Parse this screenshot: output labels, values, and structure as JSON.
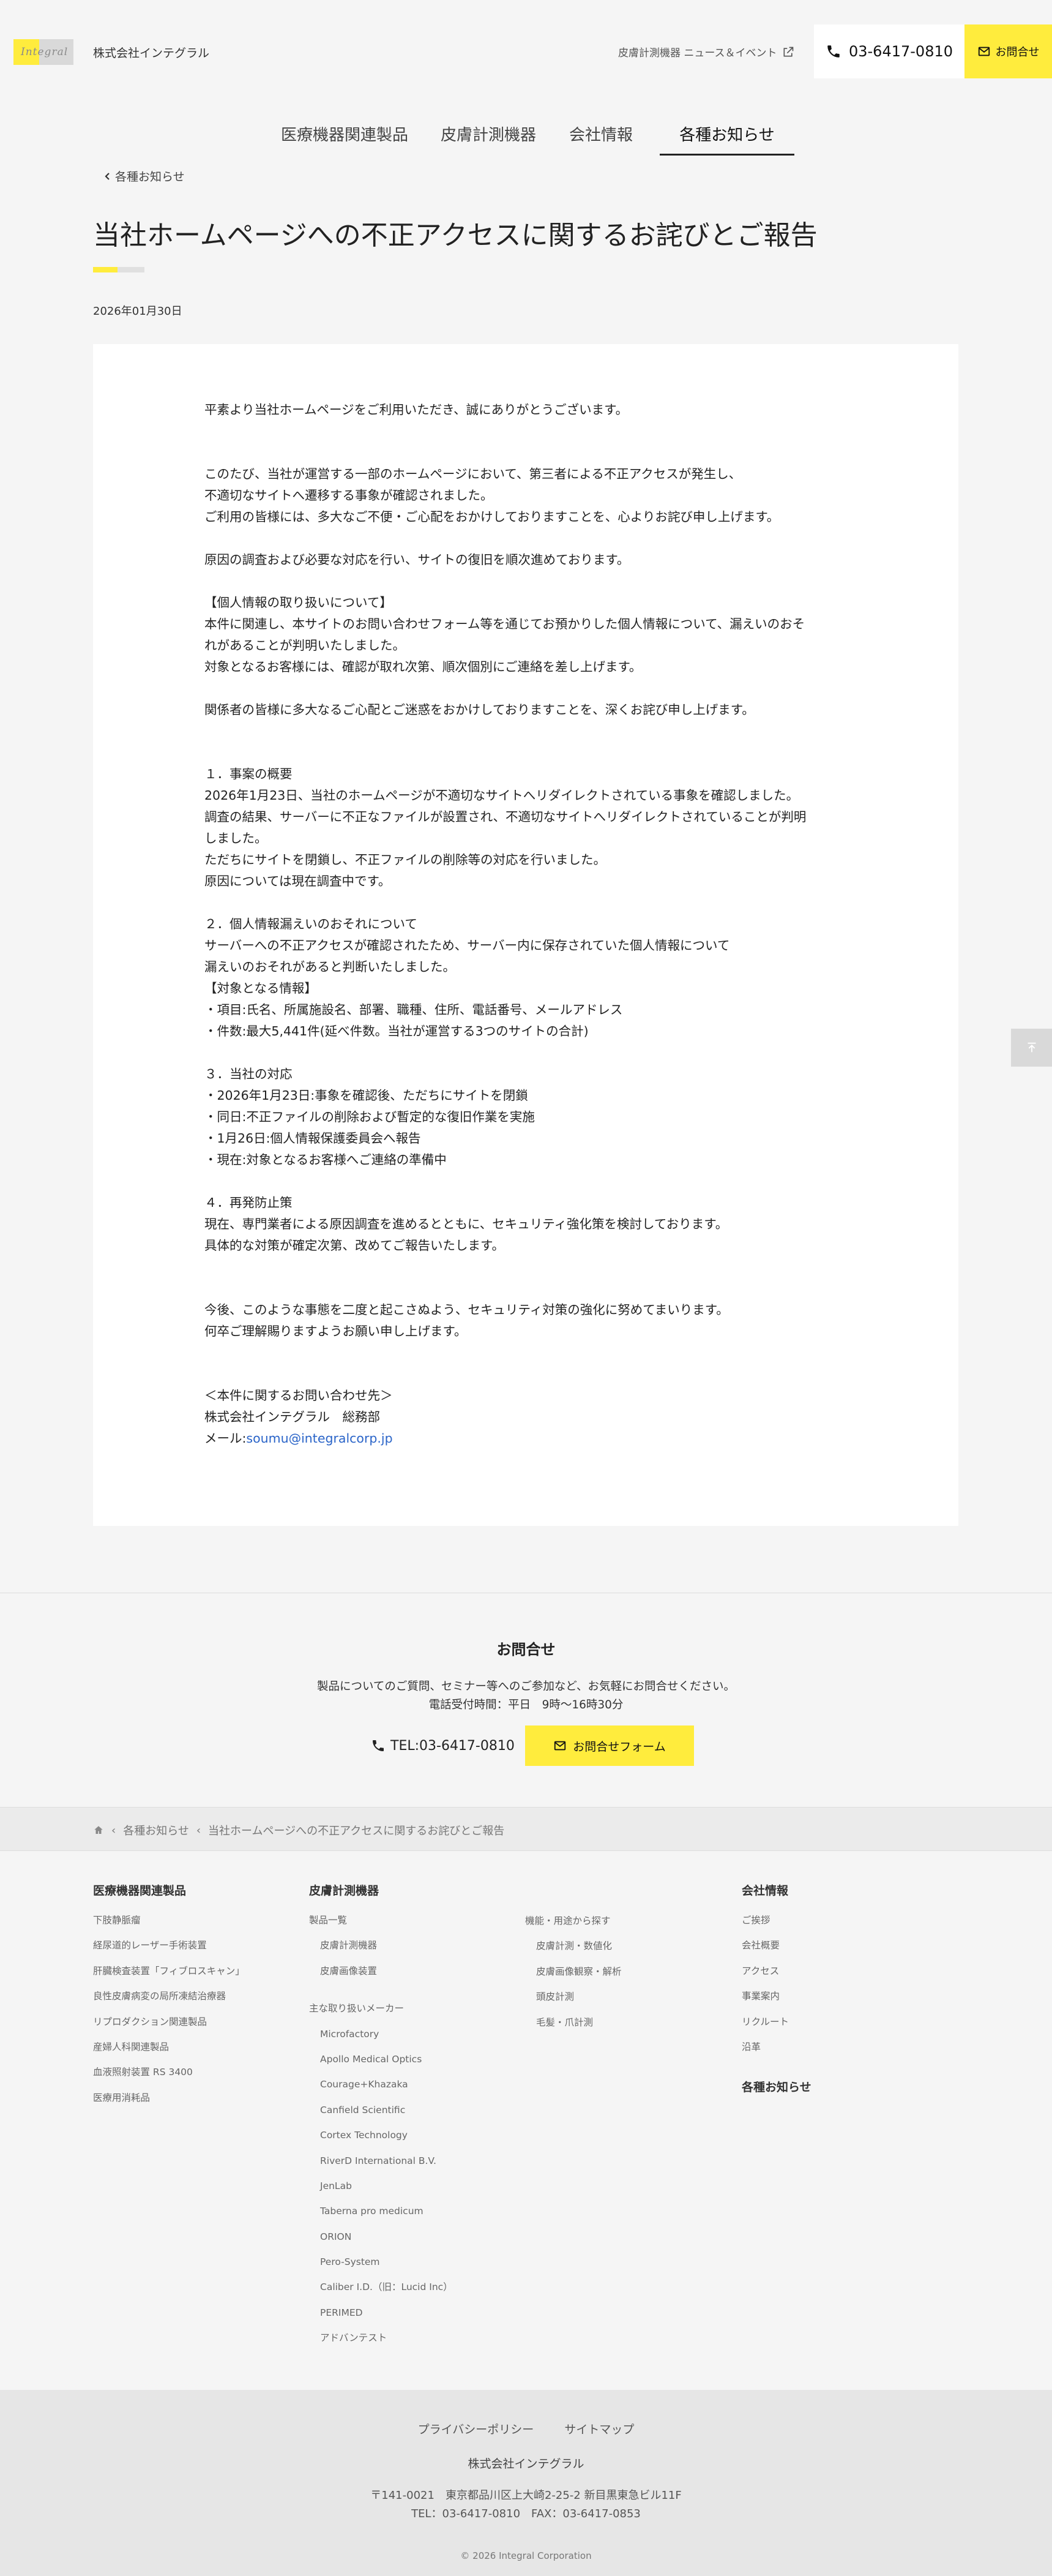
{
  "header": {
    "logo_text": "Integral",
    "company_name": "株式会社インテグラル",
    "news_link": "皮膚計測機器 ニュース＆イベント",
    "tel": "03-6417-0810",
    "contact": "お問合せ"
  },
  "nav": {
    "items": [
      "医療機器関連製品",
      "皮膚計測機器",
      "会社情報",
      "各種お知らせ"
    ],
    "active": "各種お知らせ"
  },
  "back_link": "各種お知らせ",
  "article": {
    "title": "当社ホームページへの不正アクセスに関するお詫びとご報告",
    "date": "2026年01月30日",
    "greeting": "平素より当社ホームページをご利用いただき、誠にありがとうございます。",
    "intro": [
      "このたび、当社が運営する一部のホームページにおいて、第三者による不正アクセスが発生し、",
      "不適切なサイトへ遷移する事象が確認されました。",
      "ご利用の皆様には、多大なご不便・ご心配をおかけしておりますことを、心よりお詫び申し上げます。"
    ],
    "recovery": "原因の調査および必要な対応を行い、サイトの復旧を順次進めております。",
    "personal_info": [
      "【個人情報の取り扱いについて】",
      "本件に関連し、本サイトのお問い合わせフォーム等を通じてお預かりした個人情報について、漏えいのおそ",
      "れがあることが判明いたしました。",
      "対象となるお客様には、確認が取れ次第、順次個別にご連絡を差し上げます。"
    ],
    "apology": "関係者の皆様に多大なるご心配とご迷惑をおかけしておりますことを、深くお詫び申し上げます。",
    "section1": [
      "１．事案の概要",
      "2026年1月23日、当社のホームページが不適切なサイトへリダイレクトされている事象を確認しました。",
      "調査の結果、サーバーに不正なファイルが設置され、不適切なサイトへリダイレクトされていることが判明",
      "しました。",
      "ただちにサイトを閉鎖し、不正ファイルの削除等の対応を行いました。",
      "原因については現在調査中です。"
    ],
    "section2": [
      "２．個人情報漏えいのおそれについて",
      "サーバーへの不正アクセスが確認されたため、サーバー内に保存されていた個人情報について",
      "漏えいのおそれがあると判断いたしました。",
      "【対象となる情報】",
      "・項目:氏名、所属施設名、部署、職種、住所、電話番号、メールアドレス",
      "・件数:最大5,441件(延べ件数。当社が運営する3つのサイトの合計)"
    ],
    "section3": [
      "３．当社の対応",
      "・2026年1月23日:事象を確認後、ただちにサイトを閉鎖",
      "・同日:不正ファイルの削除および暫定的な復旧作業を実施",
      "・1月26日:個人情報保護委員会へ報告",
      "・現在:対象となるお客様へご連絡の準備中"
    ],
    "section4": [
      "４．再発防止策",
      "現在、専門業者による原因調査を進めるとともに、セキュリティ強化策を検討しております。",
      "具体的な対策が確定次第、改めてご報告いたします。"
    ],
    "closing": [
      "今後、このような事態を二度と起こさぬよう、セキュリティ対策の強化に努めてまいります。",
      "何卒ご理解賜りますようお願い申し上げます。"
    ],
    "inquiry": {
      "heading": "＜本件に関するお問い合わせ先＞",
      "dept": "株式会社インテグラル　総務部",
      "mail_label": "メール:",
      "mail": "soumu@integralcorp.jp"
    }
  },
  "contact_section": {
    "title": "お問合せ",
    "desc1": "製品についてのご質問、セミナー等へのご参加など、お気軽にお問合せください。",
    "desc2": "電話受付時間：平日　9時〜16時30分",
    "tel": "TEL:03-6417-0810",
    "form": "お問合せフォーム"
  },
  "breadcrumb": [
    "各種お知らせ",
    "当社ホームページへの不正アクセスに関するお詫びとご報告"
  ],
  "footer_nav": {
    "col1": {
      "heading": "医療機器関連製品",
      "links": [
        "下肢静脈瘤",
        "経尿道的レーザー手術装置",
        "肝臓検査装置「フィブロスキャン」",
        "良性皮膚病変の局所凍結治療器",
        "リプロダクション関連製品",
        "産婦人科関連製品",
        "血液照射装置 RS 3400",
        "医療用消耗品"
      ]
    },
    "col2": {
      "heading": "皮膚計測機器",
      "group1": "製品一覧",
      "group1_links": [
        "皮膚計測機器",
        "皮膚画像装置"
      ],
      "group2": "主な取り扱いメーカー",
      "group2_links": [
        "Microfactory",
        "Apollo Medical Optics",
        "Courage+Khazaka",
        "Canfield Scientific",
        "Cortex Technology",
        "RiverD International B.V.",
        "JenLab",
        "Taberna pro medicum",
        "ORION",
        "Pero-System",
        "Caliber I.D.（旧：Lucid Inc）",
        "PERIMED",
        "アドバンテスト"
      ]
    },
    "col3": {
      "group": "機能・用途から探す",
      "links": [
        "皮膚計測・数値化",
        "皮膚画像観察・解析",
        "頭皮計測",
        "毛髪・爪計測"
      ]
    },
    "col4": {
      "heading": "会社情報",
      "links": [
        "ご挨拶",
        "会社概要",
        "アクセス",
        "事業案内",
        "リクルート",
        "沿革"
      ],
      "heading2": "各種お知らせ"
    }
  },
  "bottom_footer": {
    "privacy": "プライバシーポリシー",
    "sitemap": "サイトマップ",
    "company": "株式会社インテグラル",
    "address": "〒141-0021　東京都品川区上大崎2-25-2 新目黒東急ビル11F",
    "telfax": "TEL：03-6417-0810　FAX：03-6417-0853",
    "copyright": "© 2026 Integral Corporation"
  },
  "colors": {
    "accent": "#ffec3d",
    "link": "#2a64c8",
    "background": "#f5f5f5"
  },
  "icons": [
    "phone-icon",
    "mail-icon",
    "external-link-icon",
    "chevron-left-icon",
    "home-icon",
    "page-top-icon"
  ]
}
